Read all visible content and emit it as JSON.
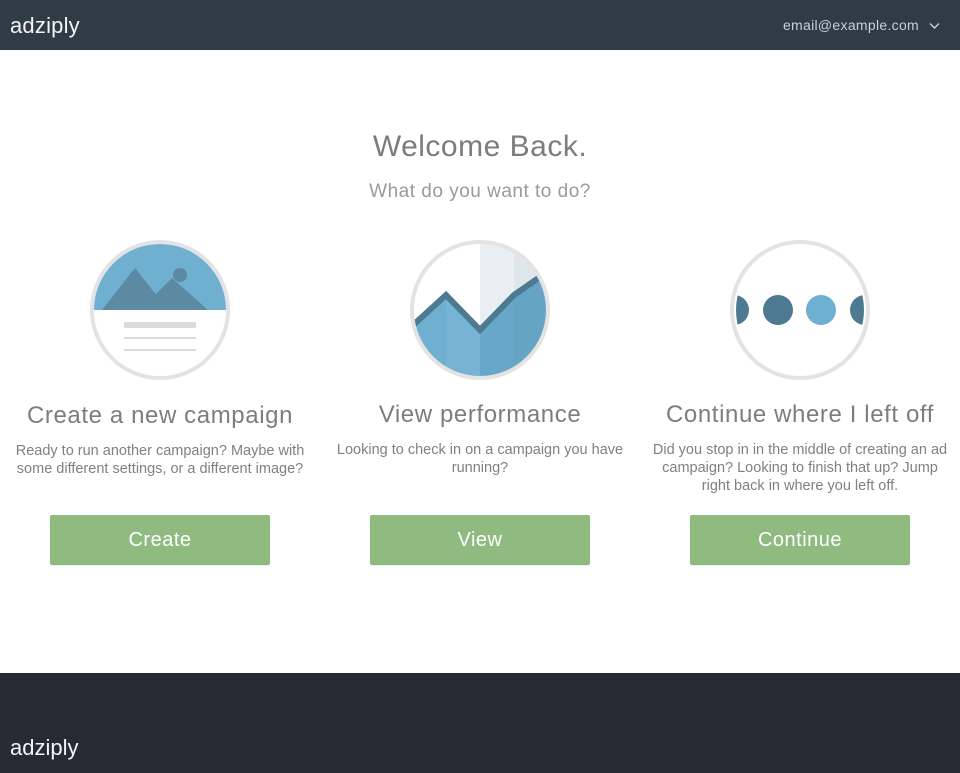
{
  "header": {
    "brand": "adziply",
    "account_email": "email@example.com",
    "account_menu_icon": "chevron-down-icon"
  },
  "hero": {
    "title": "Welcome Back.",
    "subtitle": "What do you want to do?"
  },
  "cards": [
    {
      "icon": "image-placeholder-icon",
      "title": "Create a new campaign",
      "description": "Ready to run another campaign? Maybe with some different settings, or a different image?",
      "button_label": "Create"
    },
    {
      "icon": "line-chart-icon",
      "title": "View performance",
      "description": "Looking to check in on a campaign you have running?",
      "button_label": "View"
    },
    {
      "icon": "progress-dots-icon",
      "title": "Continue where I left off",
      "description": "Did you stop in in the middle of creating an ad campaign? Looking to finish that up? Jump right back in where you left off.",
      "button_label": "Continue"
    }
  ],
  "footer": {
    "brand": "adziply"
  },
  "colors": {
    "header_bg": "#2f3b45",
    "footer_bg": "#262b33",
    "button_green": "#8fbb80",
    "illustration_blue": "#6fafd0",
    "illustration_dark_blue": "#4d7a90",
    "circle_border": "#e3e3e3"
  }
}
